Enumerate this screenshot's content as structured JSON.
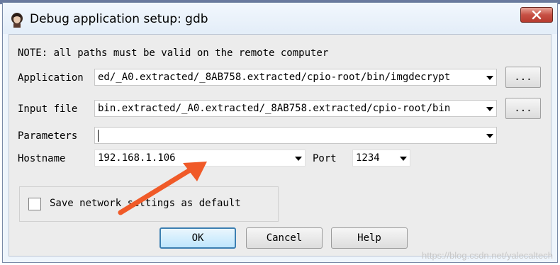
{
  "window": {
    "title": "Debug application setup: gdb",
    "close_icon": "close-icon",
    "app_icon": "portrait-icon"
  },
  "note": "NOTE: all paths must be valid on the remote computer",
  "application": {
    "label": "Application",
    "value": "ed/_A0.extracted/_8AB758.extracted/cpio-root/bin/imgdecrypt",
    "browse_label": "..."
  },
  "input_file": {
    "label": "Input file",
    "value": "bin.extracted/_A0.extracted/_8AB758.extracted/cpio-root/bin",
    "browse_label": "..."
  },
  "parameters": {
    "label": "Parameters",
    "value": ""
  },
  "hostname": {
    "label": "Hostname",
    "value": "192.168.1.106"
  },
  "port": {
    "label": "Port",
    "value": "1234"
  },
  "save_network": {
    "label": "Save network settings as default",
    "checked": false
  },
  "buttons": {
    "ok": "OK",
    "cancel": "Cancel",
    "help": "Help"
  },
  "annotation": {
    "arrow_color": "#f05a28"
  },
  "watermark": "https://blog.csdn.net/yalecaltech"
}
